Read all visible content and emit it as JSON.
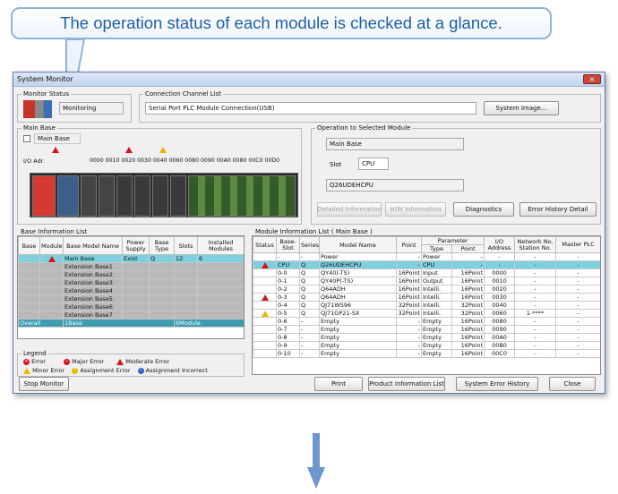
{
  "callout": {
    "text": "The operation status of each module is checked at a glance."
  },
  "window": {
    "title": "System Monitor",
    "close": "×"
  },
  "monitor_status": {
    "label": "Monitor Status",
    "state": "Monitoring"
  },
  "connection": {
    "label": "Connection Channel List",
    "value": "Serial Port  PLC Module Connection(USB)",
    "system_image": "System Image..."
  },
  "main_base": {
    "label": "Main Base",
    "checkbox_label": "Main Base",
    "io_label": "I/O Adr.",
    "io_addresses": "0000 0010 0020 0030 0040 0060 0080 0090 00A0 0080 00C0 00D0"
  },
  "operation": {
    "label": "Operation to Selected Module",
    "base": "Main Base",
    "slot_label": "Slot",
    "slot_value": "CPU",
    "model": "Q26UDEHCPU",
    "detailed_info": "Detailed Information",
    "hw_info": "H/W Information",
    "diagnostics": "Diagnostics",
    "error_history": "Error History Detail"
  },
  "base_list": {
    "label": "Base Information List",
    "headers": [
      "Base",
      "Module",
      "Base Model Name",
      "Power Supply",
      "Base Type",
      "Slots",
      "Installed Modules"
    ],
    "rows": [
      [
        "",
        "!",
        "Main Base",
        "Exist",
        "Q",
        "12",
        "6"
      ],
      [
        "",
        "",
        "Extension Base1",
        "",
        "",
        "",
        ""
      ],
      [
        "",
        "",
        "Extension Base2",
        "",
        "",
        "",
        ""
      ],
      [
        "",
        "",
        "Extension Base3",
        "",
        "",
        "",
        ""
      ],
      [
        "",
        "",
        "Extension Base4",
        "",
        "",
        "",
        ""
      ],
      [
        "",
        "",
        "Extension Base5",
        "",
        "",
        "",
        ""
      ],
      [
        "",
        "",
        "Extension Base6",
        "",
        "",
        "",
        ""
      ],
      [
        "",
        "",
        "Extension Base7",
        "",
        "",
        "",
        ""
      ]
    ],
    "overall": [
      "Overall",
      "1Base",
      "6Module"
    ]
  },
  "legend": {
    "label": "Legend",
    "error": "Error",
    "major": "Major Error",
    "moderate": "Moderate Error",
    "minor": "Minor Error",
    "assign_err": "Assignment Error",
    "assign_inc": "Assignment Incorrect"
  },
  "module_list": {
    "label": "Module Information List ( Main Base )",
    "headers": {
      "status": "Status",
      "slot": "Base-Slot",
      "series": "Series",
      "model": "Model Name",
      "point": "Point",
      "parameter": "Parameter",
      "type": "Type",
      "ppoint": "Point",
      "io": "I/O Address",
      "network": "Network No. Station No.",
      "master": "Master PLC"
    },
    "rows": [
      [
        "",
        "-",
        "-",
        "Power",
        "-",
        "Power",
        "-",
        "-",
        "-",
        "-"
      ],
      [
        "red",
        "CPU",
        "Q",
        "Q26UDEHCPU",
        "-",
        "CPU",
        "-",
        "-",
        "-",
        "-"
      ],
      [
        "",
        "0-0",
        "Q",
        "QY40(-TS)",
        "16Point",
        "Input",
        "16Point",
        "0000",
        "-",
        "-"
      ],
      [
        "",
        "0-1",
        "Q",
        "QY40P(-TS)",
        "16Point",
        "Output",
        "16Point",
        "0010",
        "-",
        "-"
      ],
      [
        "",
        "0-2",
        "Q",
        "Q64ADH",
        "16Point",
        "Intelli.",
        "16Point",
        "0020",
        "-",
        "-"
      ],
      [
        "red",
        "0-3",
        "Q",
        "Q64ADH",
        "16Point",
        "Intelli.",
        "16Point",
        "0030",
        "-",
        "-"
      ],
      [
        "",
        "0-4",
        "Q",
        "QJ71WS96",
        "32Point",
        "Intelli.",
        "32Point",
        "0040",
        "-",
        "-"
      ],
      [
        "yellow",
        "0-5",
        "Q",
        "QJ71GP21-SX",
        "32Point",
        "Intelli.",
        "32Point",
        "0060",
        "1-****",
        "-"
      ],
      [
        "",
        "0-6",
        "-",
        "Empty",
        "-",
        "Empty",
        "16Point",
        "0080",
        "-",
        "-"
      ],
      [
        "",
        "0-7",
        "-",
        "Empty",
        "-",
        "Empty",
        "16Point",
        "0090",
        "-",
        "-"
      ],
      [
        "",
        "0-8",
        "-",
        "Empty",
        "-",
        "Empty",
        "16Point",
        "00A0",
        "-",
        "-"
      ],
      [
        "",
        "0-9",
        "-",
        "Empty",
        "-",
        "Empty",
        "16Point",
        "00B0",
        "-",
        "-"
      ],
      [
        "",
        "0-10",
        "-",
        "Empty",
        "-",
        "Empty",
        "16Point",
        "00C0",
        "-",
        "-"
      ]
    ]
  },
  "footer": {
    "stop": "Stop Monitor",
    "print": "Print",
    "product": "Product Information List",
    "sys_err": "System Error History",
    "close": "Close"
  },
  "colors": {
    "accent": "#1d5fa7",
    "selected_row": "#7fd0de",
    "error": "#d8141b",
    "warning": "#e6b800"
  }
}
